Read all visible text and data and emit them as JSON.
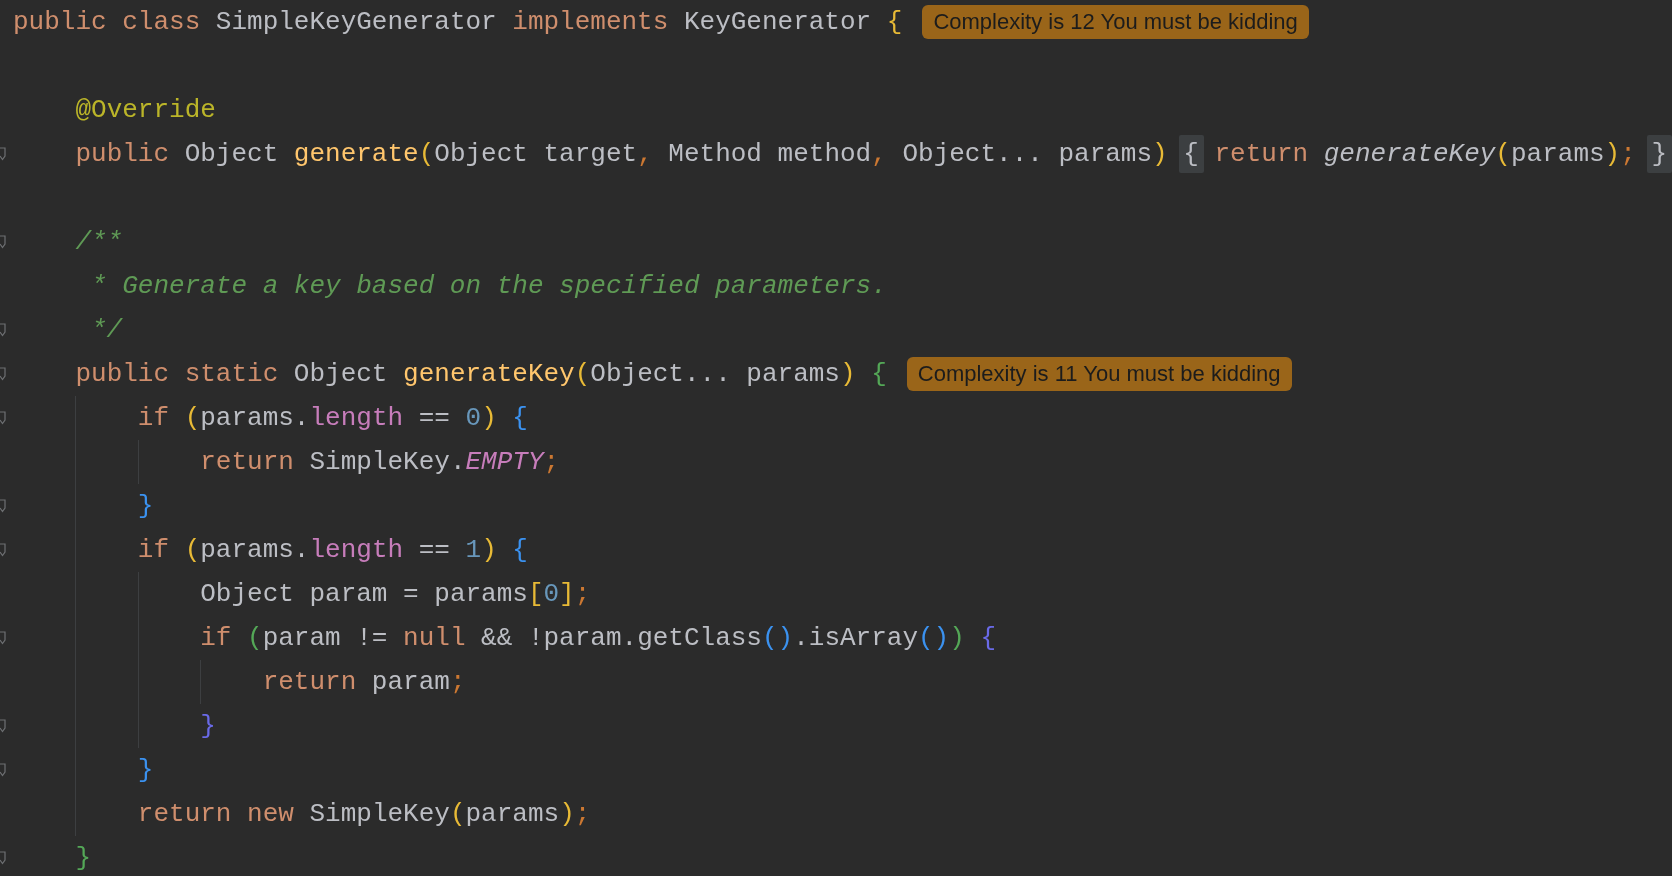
{
  "editor": {
    "lines": [
      {
        "fold_marker": false,
        "tokens": [
          {
            "text": "public class ",
            "kind": "kw"
          },
          {
            "text": "SimpleKeyGenerator ",
            "kind": "plain"
          },
          {
            "text": "implements ",
            "kind": "kw"
          },
          {
            "text": "KeyGenerator ",
            "kind": "plain"
          },
          {
            "text": "{",
            "kind": "p1"
          }
        ],
        "hint": "Complexity is 12 You must be kidding"
      },
      {
        "fold_marker": false
      },
      {
        "fold_marker": false,
        "tokens": [
          {
            "text": "    @Override",
            "kind": "ann"
          }
        ]
      },
      {
        "fold_marker": true,
        "tokens": [
          {
            "text": "    public ",
            "kind": "kw"
          },
          {
            "text": "Object ",
            "kind": "plain"
          },
          {
            "text": "generate",
            "kind": "decl"
          },
          {
            "text": "(",
            "kind": "p1"
          },
          {
            "text": "Object target",
            "kind": "plain"
          },
          {
            "text": ", ",
            "kind": "punc"
          },
          {
            "text": "Method method",
            "kind": "plain"
          },
          {
            "text": ", ",
            "kind": "punc"
          },
          {
            "text": "Object... params",
            "kind": "plain"
          },
          {
            "text": ") ",
            "kind": "p1"
          },
          {
            "text": "{",
            "kind": "fold"
          },
          {
            "text": " return ",
            "kind": "kw"
          },
          {
            "text": "generateKey",
            "kind": "call"
          },
          {
            "text": "(",
            "kind": "p1"
          },
          {
            "text": "params",
            "kind": "plain"
          },
          {
            "text": ")",
            "kind": "p1"
          },
          {
            "text": "; ",
            "kind": "punc"
          },
          {
            "text": "}",
            "kind": "fold"
          }
        ]
      },
      {
        "fold_marker": false
      },
      {
        "fold_marker": true,
        "tokens": [
          {
            "text": "    /**",
            "kind": "doc"
          }
        ]
      },
      {
        "fold_marker": false,
        "tokens": [
          {
            "text": "     * Generate a key based on the specified parameters.",
            "kind": "doc"
          }
        ]
      },
      {
        "fold_marker": true,
        "tokens": [
          {
            "text": "     */",
            "kind": "doc"
          }
        ]
      },
      {
        "fold_marker": true,
        "tokens": [
          {
            "text": "    public static ",
            "kind": "kw"
          },
          {
            "text": "Object ",
            "kind": "plain"
          },
          {
            "text": "generateKey",
            "kind": "decl"
          },
          {
            "text": "(",
            "kind": "p1"
          },
          {
            "text": "Object... params",
            "kind": "plain"
          },
          {
            "text": ") ",
            "kind": "p1"
          },
          {
            "text": "{",
            "kind": "p3"
          }
        ],
        "hint": "Complexity is 11 You must be kidding"
      },
      {
        "fold_marker": true,
        "tokens": [
          {
            "text": "        if ",
            "kind": "kw"
          },
          {
            "text": "(",
            "kind": "p1"
          },
          {
            "text": "params.",
            "kind": "plain"
          },
          {
            "text": "length",
            "kind": "field"
          },
          {
            "text": " == ",
            "kind": "plain"
          },
          {
            "text": "0",
            "kind": "num"
          },
          {
            "text": ") ",
            "kind": "p1"
          },
          {
            "text": "{",
            "kind": "p2"
          }
        ]
      },
      {
        "fold_marker": false,
        "tokens": [
          {
            "text": "            return ",
            "kind": "kw"
          },
          {
            "text": "SimpleKey.",
            "kind": "plain"
          },
          {
            "text": "EMPTY",
            "kind": "static"
          },
          {
            "text": ";",
            "kind": "punc"
          }
        ]
      },
      {
        "fold_marker": true,
        "tokens": [
          {
            "text": "        }",
            "kind": "p2"
          }
        ]
      },
      {
        "fold_marker": true,
        "tokens": [
          {
            "text": "        if ",
            "kind": "kw"
          },
          {
            "text": "(",
            "kind": "p1"
          },
          {
            "text": "params.",
            "kind": "plain"
          },
          {
            "text": "length",
            "kind": "field"
          },
          {
            "text": " == ",
            "kind": "plain"
          },
          {
            "text": "1",
            "kind": "num"
          },
          {
            "text": ") ",
            "kind": "p1"
          },
          {
            "text": "{",
            "kind": "p2"
          }
        ]
      },
      {
        "fold_marker": false,
        "tokens": [
          {
            "text": "            Object param = params",
            "kind": "plain"
          },
          {
            "text": "[",
            "kind": "p1"
          },
          {
            "text": "0",
            "kind": "num"
          },
          {
            "text": "]",
            "kind": "p1"
          },
          {
            "text": ";",
            "kind": "punc"
          }
        ]
      },
      {
        "fold_marker": true,
        "tokens": [
          {
            "text": "            if ",
            "kind": "kw"
          },
          {
            "text": "(",
            "kind": "p3"
          },
          {
            "text": "param != ",
            "kind": "plain"
          },
          {
            "text": "null ",
            "kind": "kw"
          },
          {
            "text": "&& !param.getClass",
            "kind": "plain"
          },
          {
            "text": "()",
            "kind": "p2"
          },
          {
            "text": ".isArray",
            "kind": "plain"
          },
          {
            "text": "()",
            "kind": "p2"
          },
          {
            "text": ") ",
            "kind": "p3"
          },
          {
            "text": "{",
            "kind": "p4"
          }
        ]
      },
      {
        "fold_marker": false,
        "tokens": [
          {
            "text": "                return ",
            "kind": "kw"
          },
          {
            "text": "param",
            "kind": "plain"
          },
          {
            "text": ";",
            "kind": "punc"
          }
        ]
      },
      {
        "fold_marker": true,
        "tokens": [
          {
            "text": "            }",
            "kind": "p4"
          }
        ]
      },
      {
        "fold_marker": true,
        "tokens": [
          {
            "text": "        }",
            "kind": "p2"
          }
        ]
      },
      {
        "fold_marker": false,
        "tokens": [
          {
            "text": "        return new ",
            "kind": "kw"
          },
          {
            "text": "SimpleKey",
            "kind": "plain"
          },
          {
            "text": "(",
            "kind": "p1"
          },
          {
            "text": "params",
            "kind": "plain"
          },
          {
            "text": ")",
            "kind": "p1"
          },
          {
            "text": ";",
            "kind": "punc"
          }
        ]
      },
      {
        "fold_marker": true,
        "tokens": [
          {
            "text": "    }",
            "kind": "p3"
          }
        ]
      }
    ]
  }
}
